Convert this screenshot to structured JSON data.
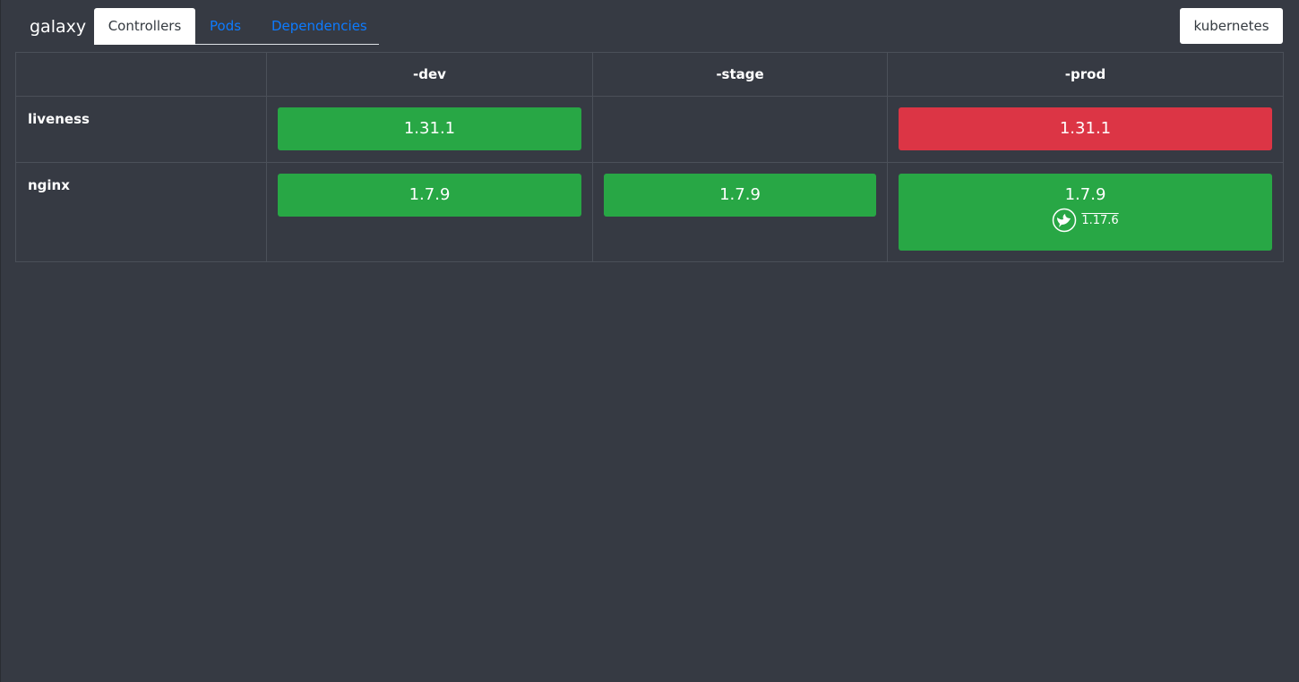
{
  "app": {
    "brand": "galaxy"
  },
  "tabs": [
    {
      "label": "Controllers",
      "active": true
    },
    {
      "label": "Pods",
      "active": false
    },
    {
      "label": "Dependencies",
      "active": false
    }
  ],
  "namespace_button": "kubernetes",
  "table": {
    "columns": [
      "",
      "-dev",
      "-stage",
      "-prod"
    ],
    "rows": [
      {
        "name": "liveness",
        "dev": {
          "version": "1.31.1",
          "status": "ok"
        },
        "stage": null,
        "prod": {
          "version": "1.31.1",
          "status": "bad"
        }
      },
      {
        "name": "nginx",
        "dev": {
          "version": "1.7.9",
          "status": "ok"
        },
        "stage": {
          "version": "1.7.9",
          "status": "ok"
        },
        "prod": {
          "version": "1.7.9",
          "status": "ok",
          "update_icon": "bird-icon",
          "update_version": "1.17.6"
        }
      }
    ]
  },
  "colors": {
    "background": "#363a43",
    "ok": "#28a745",
    "bad": "#dc3545",
    "link": "#0d7bff"
  }
}
